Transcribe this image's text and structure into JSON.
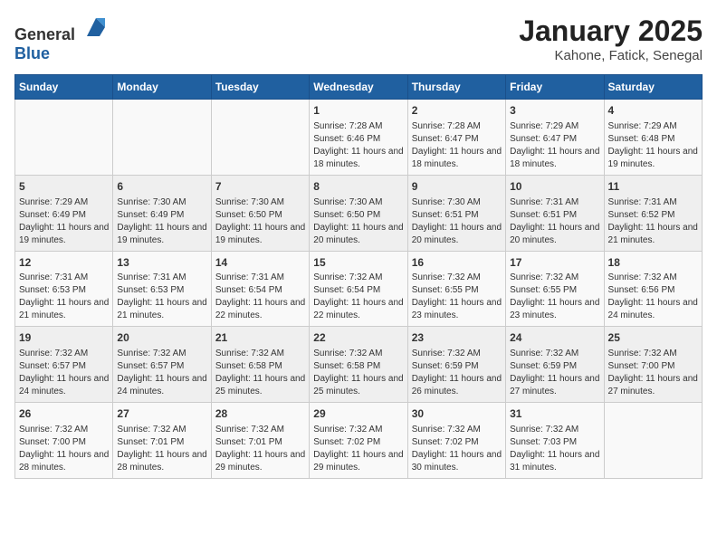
{
  "header": {
    "logo_general": "General",
    "logo_blue": "Blue",
    "title": "January 2025",
    "subtitle": "Kahone, Fatick, Senegal"
  },
  "days_of_week": [
    "Sunday",
    "Monday",
    "Tuesday",
    "Wednesday",
    "Thursday",
    "Friday",
    "Saturday"
  ],
  "weeks": [
    [
      {
        "day": "",
        "sunrise": "",
        "sunset": "",
        "daylight": ""
      },
      {
        "day": "",
        "sunrise": "",
        "sunset": "",
        "daylight": ""
      },
      {
        "day": "",
        "sunrise": "",
        "sunset": "",
        "daylight": ""
      },
      {
        "day": "1",
        "sunrise": "7:28 AM",
        "sunset": "6:46 PM",
        "daylight": "11 hours and 18 minutes."
      },
      {
        "day": "2",
        "sunrise": "7:28 AM",
        "sunset": "6:47 PM",
        "daylight": "11 hours and 18 minutes."
      },
      {
        "day": "3",
        "sunrise": "7:29 AM",
        "sunset": "6:47 PM",
        "daylight": "11 hours and 18 minutes."
      },
      {
        "day": "4",
        "sunrise": "7:29 AM",
        "sunset": "6:48 PM",
        "daylight": "11 hours and 19 minutes."
      }
    ],
    [
      {
        "day": "5",
        "sunrise": "7:29 AM",
        "sunset": "6:49 PM",
        "daylight": "11 hours and 19 minutes."
      },
      {
        "day": "6",
        "sunrise": "7:30 AM",
        "sunset": "6:49 PM",
        "daylight": "11 hours and 19 minutes."
      },
      {
        "day": "7",
        "sunrise": "7:30 AM",
        "sunset": "6:50 PM",
        "daylight": "11 hours and 19 minutes."
      },
      {
        "day": "8",
        "sunrise": "7:30 AM",
        "sunset": "6:50 PM",
        "daylight": "11 hours and 20 minutes."
      },
      {
        "day": "9",
        "sunrise": "7:30 AM",
        "sunset": "6:51 PM",
        "daylight": "11 hours and 20 minutes."
      },
      {
        "day": "10",
        "sunrise": "7:31 AM",
        "sunset": "6:51 PM",
        "daylight": "11 hours and 20 minutes."
      },
      {
        "day": "11",
        "sunrise": "7:31 AM",
        "sunset": "6:52 PM",
        "daylight": "11 hours and 21 minutes."
      }
    ],
    [
      {
        "day": "12",
        "sunrise": "7:31 AM",
        "sunset": "6:53 PM",
        "daylight": "11 hours and 21 minutes."
      },
      {
        "day": "13",
        "sunrise": "7:31 AM",
        "sunset": "6:53 PM",
        "daylight": "11 hours and 21 minutes."
      },
      {
        "day": "14",
        "sunrise": "7:31 AM",
        "sunset": "6:54 PM",
        "daylight": "11 hours and 22 minutes."
      },
      {
        "day": "15",
        "sunrise": "7:32 AM",
        "sunset": "6:54 PM",
        "daylight": "11 hours and 22 minutes."
      },
      {
        "day": "16",
        "sunrise": "7:32 AM",
        "sunset": "6:55 PM",
        "daylight": "11 hours and 23 minutes."
      },
      {
        "day": "17",
        "sunrise": "7:32 AM",
        "sunset": "6:55 PM",
        "daylight": "11 hours and 23 minutes."
      },
      {
        "day": "18",
        "sunrise": "7:32 AM",
        "sunset": "6:56 PM",
        "daylight": "11 hours and 24 minutes."
      }
    ],
    [
      {
        "day": "19",
        "sunrise": "7:32 AM",
        "sunset": "6:57 PM",
        "daylight": "11 hours and 24 minutes."
      },
      {
        "day": "20",
        "sunrise": "7:32 AM",
        "sunset": "6:57 PM",
        "daylight": "11 hours and 24 minutes."
      },
      {
        "day": "21",
        "sunrise": "7:32 AM",
        "sunset": "6:58 PM",
        "daylight": "11 hours and 25 minutes."
      },
      {
        "day": "22",
        "sunrise": "7:32 AM",
        "sunset": "6:58 PM",
        "daylight": "11 hours and 25 minutes."
      },
      {
        "day": "23",
        "sunrise": "7:32 AM",
        "sunset": "6:59 PM",
        "daylight": "11 hours and 26 minutes."
      },
      {
        "day": "24",
        "sunrise": "7:32 AM",
        "sunset": "6:59 PM",
        "daylight": "11 hours and 27 minutes."
      },
      {
        "day": "25",
        "sunrise": "7:32 AM",
        "sunset": "7:00 PM",
        "daylight": "11 hours and 27 minutes."
      }
    ],
    [
      {
        "day": "26",
        "sunrise": "7:32 AM",
        "sunset": "7:00 PM",
        "daylight": "11 hours and 28 minutes."
      },
      {
        "day": "27",
        "sunrise": "7:32 AM",
        "sunset": "7:01 PM",
        "daylight": "11 hours and 28 minutes."
      },
      {
        "day": "28",
        "sunrise": "7:32 AM",
        "sunset": "7:01 PM",
        "daylight": "11 hours and 29 minutes."
      },
      {
        "day": "29",
        "sunrise": "7:32 AM",
        "sunset": "7:02 PM",
        "daylight": "11 hours and 29 minutes."
      },
      {
        "day": "30",
        "sunrise": "7:32 AM",
        "sunset": "7:02 PM",
        "daylight": "11 hours and 30 minutes."
      },
      {
        "day": "31",
        "sunrise": "7:32 AM",
        "sunset": "7:03 PM",
        "daylight": "11 hours and 31 minutes."
      },
      {
        "day": "",
        "sunrise": "",
        "sunset": "",
        "daylight": ""
      }
    ]
  ],
  "labels": {
    "sunrise": "Sunrise:",
    "sunset": "Sunset:",
    "daylight": "Daylight:"
  }
}
